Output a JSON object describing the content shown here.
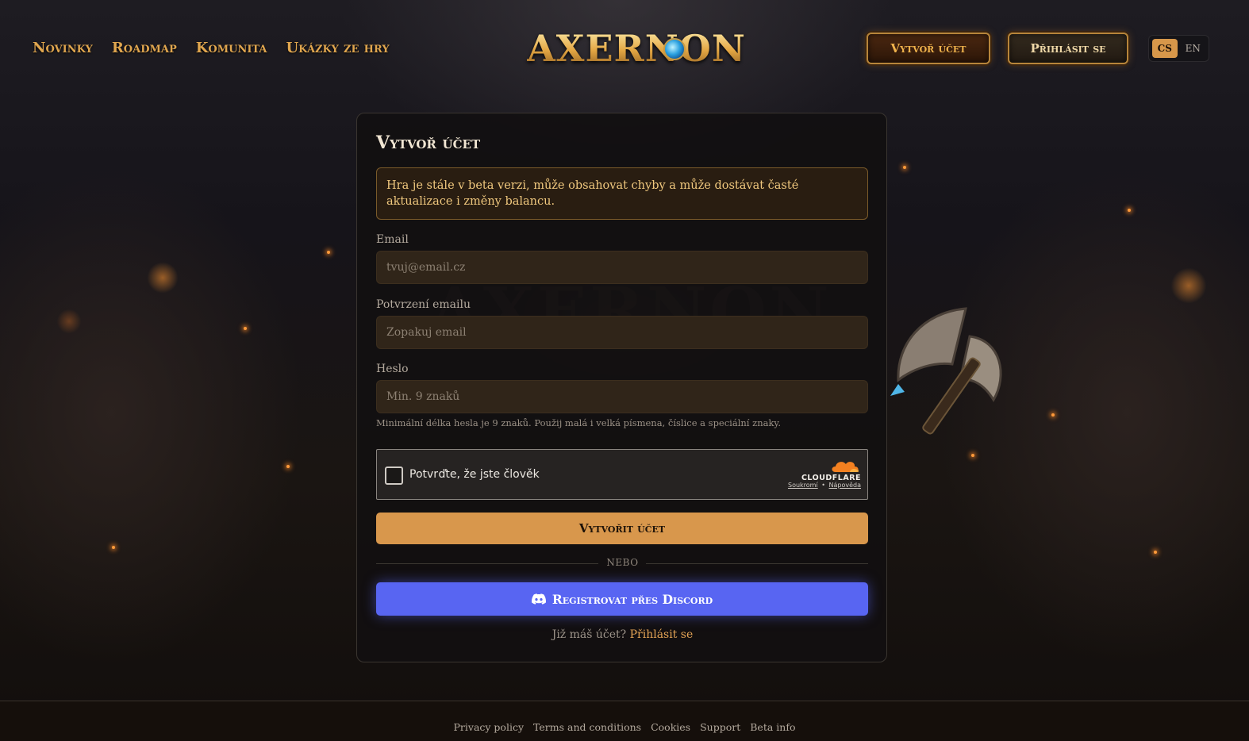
{
  "header": {
    "nav": [
      {
        "label": "Novinky"
      },
      {
        "label": "Roadmap"
      },
      {
        "label": "Komunita"
      },
      {
        "label": "Ukázky ze hry"
      }
    ],
    "logo_text": "AXERNON",
    "create_account_label": "Vytvoř účet",
    "login_label": "Přihlásit se",
    "languages": [
      {
        "code": "CS",
        "active": true
      },
      {
        "code": "EN",
        "active": false
      }
    ]
  },
  "form": {
    "title": "Vytvoř účet",
    "beta_notice": "Hra je stále v beta verzi, může obsahovat chyby a může dostávat časté aktualizace i změny balancu.",
    "email": {
      "label": "Email",
      "placeholder": "tvuj@email.cz",
      "value": ""
    },
    "email_confirm": {
      "label": "Potvrzení emailu",
      "placeholder": "Zopakuj email",
      "value": ""
    },
    "password": {
      "label": "Heslo",
      "placeholder": "Min. 9 znaků",
      "value": "",
      "hint": "Minimální délka hesla je 9 znaků. Použij malá i velká písmena, číslice a speciální znaky."
    },
    "captcha": {
      "text": "Potvrďte, že jste člověk",
      "checked": false,
      "brand": "CLOUDFLARE",
      "privacy": "Soukromí",
      "separator": "•",
      "help": "Nápověda"
    },
    "submit_label": "Vytvořit účet",
    "or_text": "NEBO",
    "discord_label": "Registrovat přes Discord",
    "already_text": "Již máš účet?",
    "login_link": "Přihlásit se"
  },
  "footer": {
    "links": [
      {
        "label": "Privacy policy"
      },
      {
        "label": "Terms and conditions"
      },
      {
        "label": "Cookies"
      },
      {
        "label": "Support"
      },
      {
        "label": "Beta info"
      }
    ]
  },
  "colors": {
    "accent": "#d8974c",
    "discord": "#5865f2",
    "gold_text": "#e0a64f"
  }
}
